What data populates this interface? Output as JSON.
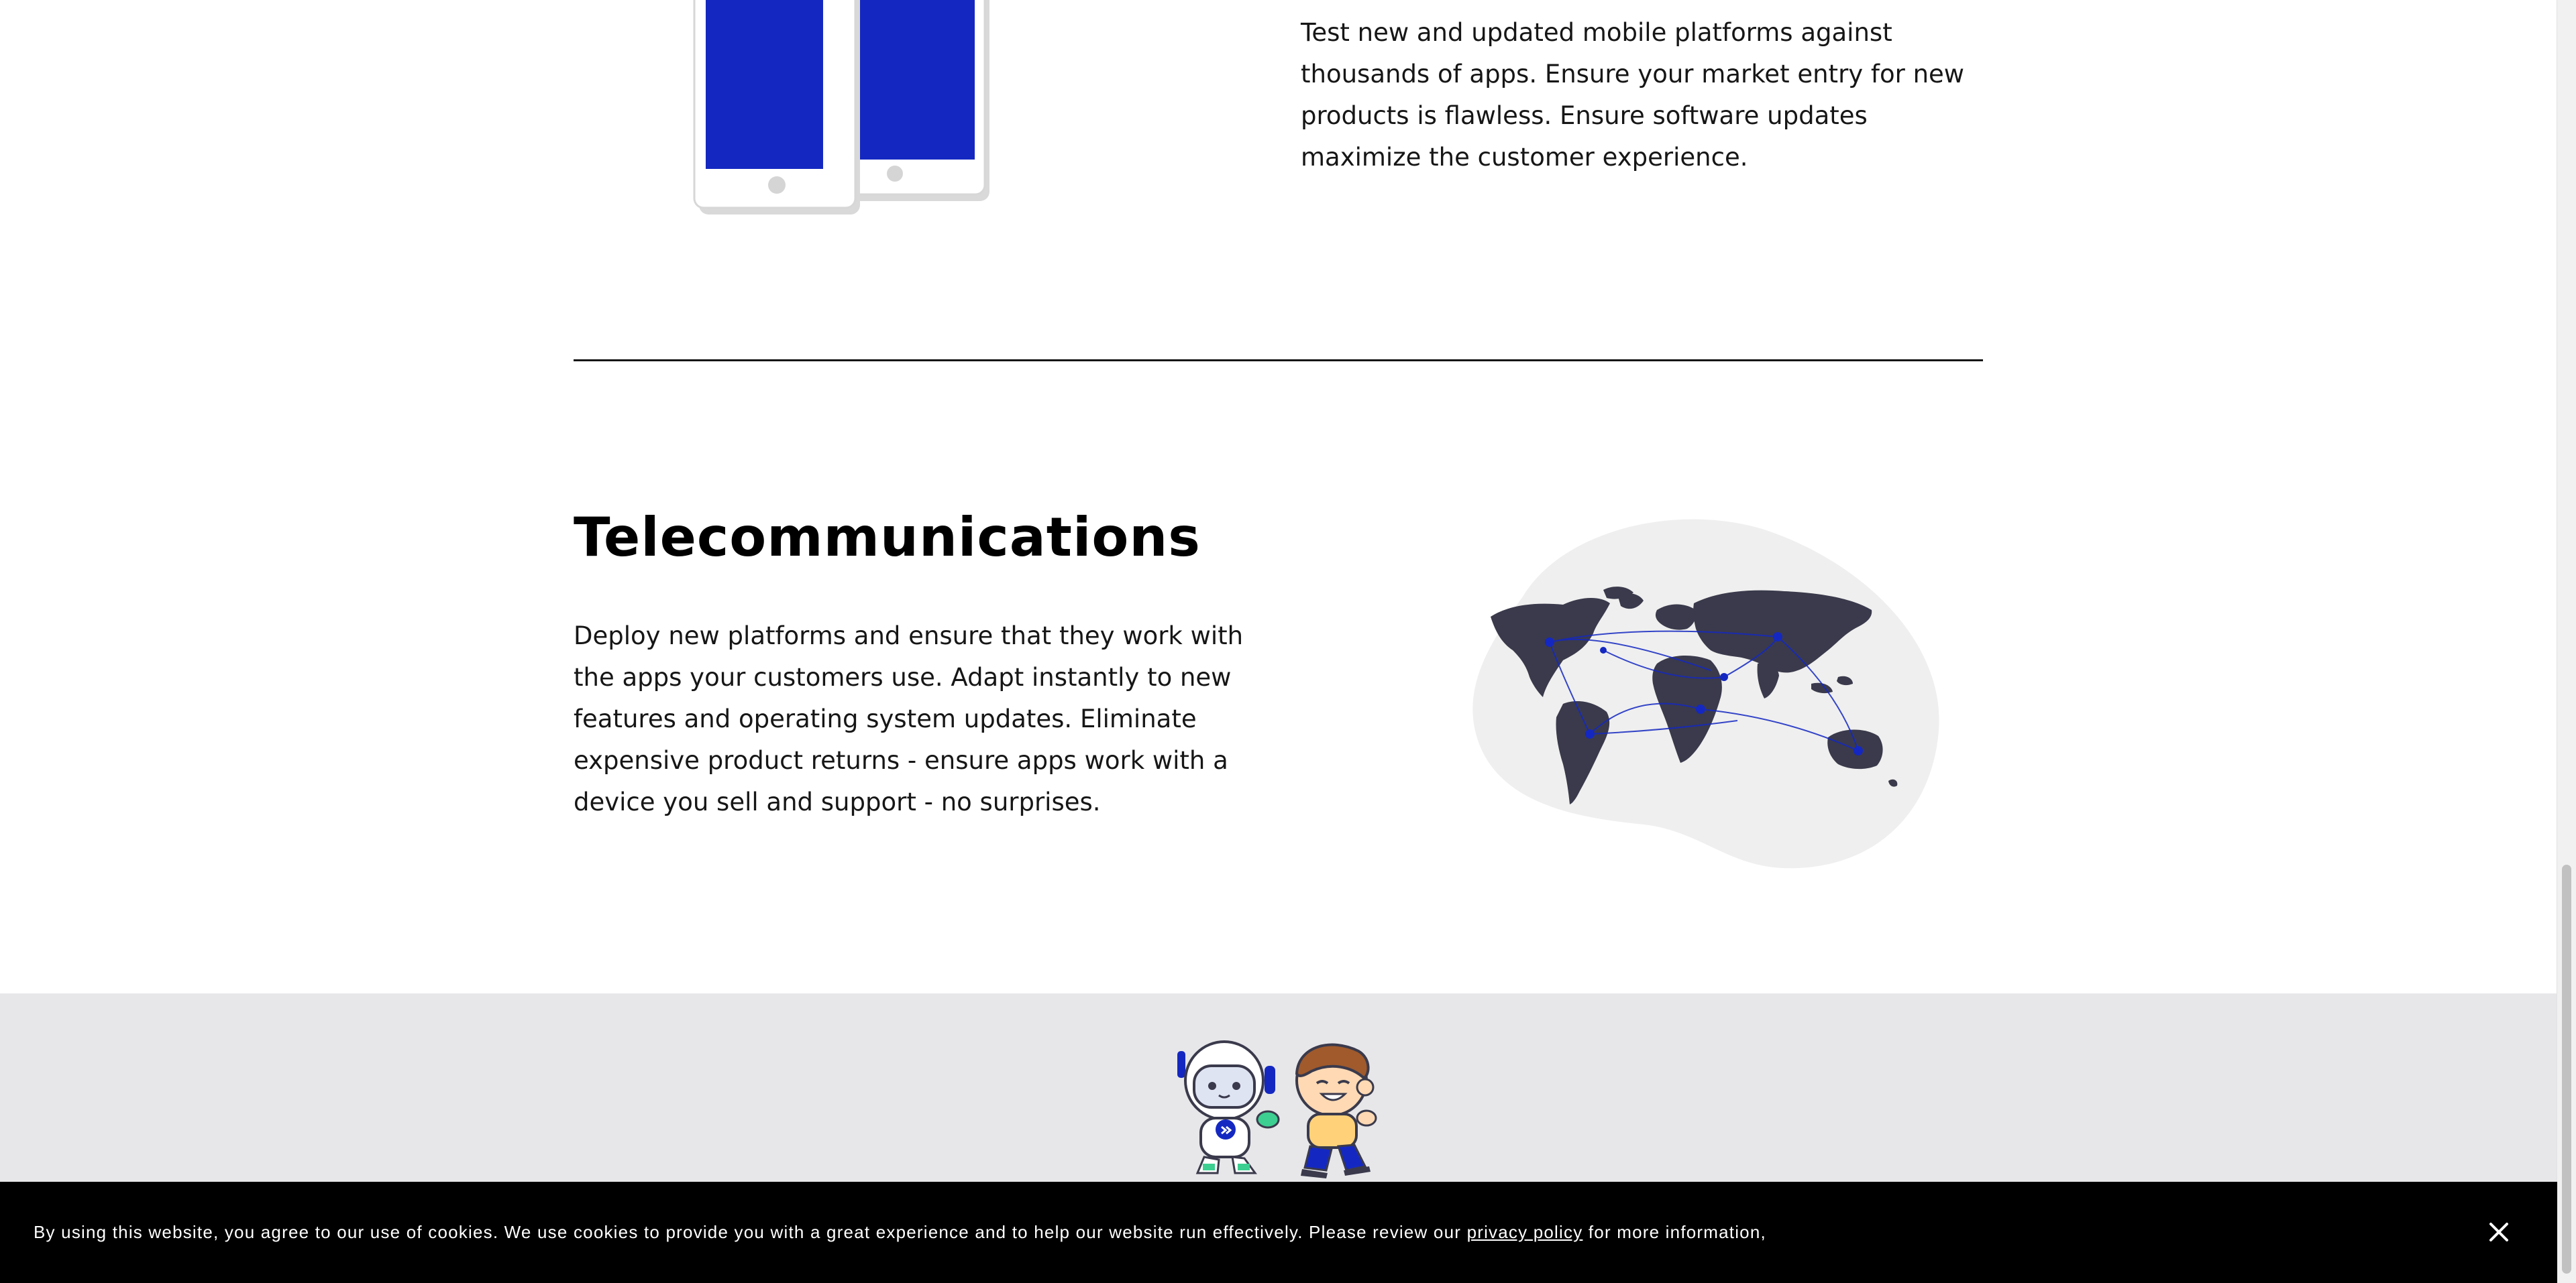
{
  "mobile_section": {
    "description": "Test new and updated mobile platforms against thousands of apps. Ensure your market entry for new products is flawless. Ensure software updates maximize the customer experience.",
    "illustration_icon": "phones-illustration"
  },
  "telecom_section": {
    "title": "Telecommunications",
    "description": "Deploy new platforms and ensure that they work with the apps your customers use. Adapt instantly to new features and operating system updates. Eliminate expensive product returns - ensure apps work with a device you sell and support - no surprises.",
    "illustration_icon": "world-map-illustration"
  },
  "footer_band": {
    "illustration_icon": "robot-and-boy-mascot-illustration"
  },
  "cookie_banner": {
    "text_before": "By using this website, you agree to our use of cookies. We use cookies to provide you with a great experience and to help our website run effectively. Please review our",
    "link_label": "privacy policy",
    "text_after": "for more information,",
    "close_icon": "close-icon"
  },
  "colors": {
    "accent_blue": "#1428c1",
    "map_dark": "#3a3a4c",
    "band_gray": "#e7e7ea",
    "banner_black": "#000000"
  }
}
